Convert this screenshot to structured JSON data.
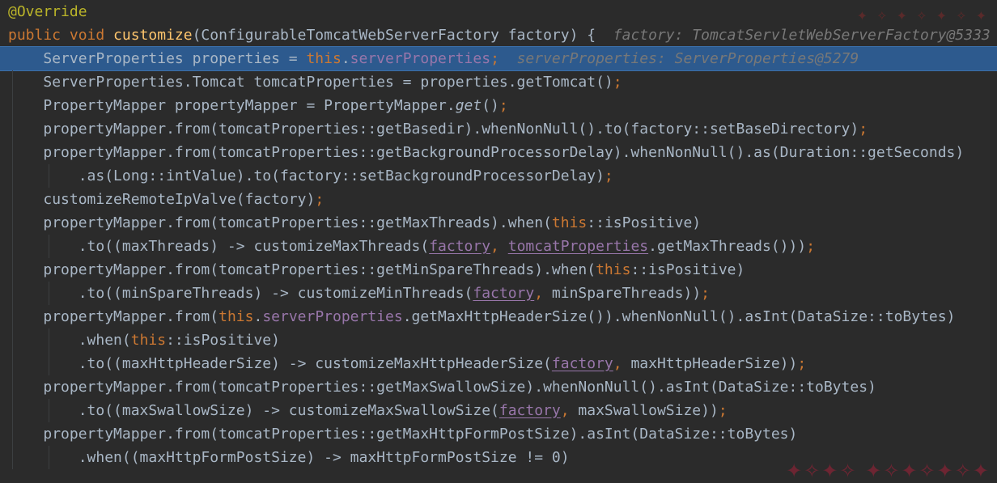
{
  "lines": [
    {
      "indent": 0,
      "current": false,
      "tokens": [
        {
          "t": "@Override",
          "c": "t-anno"
        }
      ]
    },
    {
      "indent": 0,
      "current": false,
      "tokens": [
        {
          "t": "public ",
          "c": "t-kw"
        },
        {
          "t": "void ",
          "c": "t-kw"
        },
        {
          "t": "customize",
          "c": "t-fn"
        },
        {
          "t": "(ConfigurableTomcatWebServerFactory factory) {  ",
          "c": "t-pl"
        },
        {
          "t": "factory: TomcatServletWebServerFactory@5333",
          "c": "t-hint"
        }
      ]
    },
    {
      "indent": 1,
      "current": true,
      "tokens": [
        {
          "t": "ServerProperties properties = ",
          "c": "t-pl"
        },
        {
          "t": "this",
          "c": "t-kw"
        },
        {
          "t": ".",
          "c": "t-pl"
        },
        {
          "t": "serverProperties",
          "c": "t-fld"
        },
        {
          "t": ";  ",
          "c": "t-kw"
        },
        {
          "t": "serverProperties: ServerProperties@5279",
          "c": "t-hint"
        }
      ]
    },
    {
      "indent": 1,
      "current": false,
      "tokens": [
        {
          "t": "ServerProperties.Tomcat tomcatProperties = properties.getTomcat()",
          "c": "t-pl"
        },
        {
          "t": ";",
          "c": "t-kw"
        }
      ]
    },
    {
      "indent": 1,
      "current": false,
      "tokens": [
        {
          "t": "PropertyMapper propertyMapper = PropertyMapper.",
          "c": "t-pl"
        },
        {
          "t": "get",
          "c": "t-pl t-it"
        },
        {
          "t": "()",
          "c": "t-pl"
        },
        {
          "t": ";",
          "c": "t-kw"
        }
      ]
    },
    {
      "indent": 1,
      "current": false,
      "tokens": [
        {
          "t": "propertyMapper.from(tomcatProperties::getBasedir).whenNonNull().to(factory::setBaseDirectory)",
          "c": "t-pl"
        },
        {
          "t": ";",
          "c": "t-kw"
        }
      ]
    },
    {
      "indent": 1,
      "current": false,
      "tokens": [
        {
          "t": "propertyMapper.from(tomcatProperties::getBackgroundProcessorDelay).whenNonNull().as(Duration::getSeconds)",
          "c": "t-pl"
        }
      ]
    },
    {
      "indent": 2,
      "current": false,
      "tokens": [
        {
          "t": ".as(Long::intValue).to(factory::setBackgroundProcessorDelay)",
          "c": "t-pl"
        },
        {
          "t": ";",
          "c": "t-kw"
        }
      ]
    },
    {
      "indent": 1,
      "current": false,
      "tokens": [
        {
          "t": "customizeRemoteIpValve(factory)",
          "c": "t-pl"
        },
        {
          "t": ";",
          "c": "t-kw"
        }
      ]
    },
    {
      "indent": 1,
      "current": false,
      "tokens": [
        {
          "t": "propertyMapper.from(tomcatProperties::getMaxThreads).when(",
          "c": "t-pl"
        },
        {
          "t": "this",
          "c": "t-kw"
        },
        {
          "t": "::isPositive)",
          "c": "t-pl"
        }
      ]
    },
    {
      "indent": 2,
      "current": false,
      "tokens": [
        {
          "t": ".to((maxThreads) -> customizeMaxThreads(",
          "c": "t-pl"
        },
        {
          "t": "factory",
          "c": "t-fld t-ul"
        },
        {
          "t": ", ",
          "c": "t-kw"
        },
        {
          "t": "tomcatProperties",
          "c": "t-fld t-ul"
        },
        {
          "t": ".getMaxThreads()))",
          "c": "t-pl"
        },
        {
          "t": ";",
          "c": "t-kw"
        }
      ]
    },
    {
      "indent": 1,
      "current": false,
      "tokens": [
        {
          "t": "propertyMapper.from(tomcatProperties::getMinSpareThreads).when(",
          "c": "t-pl"
        },
        {
          "t": "this",
          "c": "t-kw"
        },
        {
          "t": "::isPositive)",
          "c": "t-pl"
        }
      ]
    },
    {
      "indent": 2,
      "current": false,
      "tokens": [
        {
          "t": ".to((minSpareThreads) -> customizeMinThreads(",
          "c": "t-pl"
        },
        {
          "t": "factory",
          "c": "t-fld t-ul"
        },
        {
          "t": ", ",
          "c": "t-kw"
        },
        {
          "t": "minSpareThreads))",
          "c": "t-pl"
        },
        {
          "t": ";",
          "c": "t-kw"
        }
      ]
    },
    {
      "indent": 1,
      "current": false,
      "tokens": [
        {
          "t": "propertyMapper.from(",
          "c": "t-pl"
        },
        {
          "t": "this",
          "c": "t-kw"
        },
        {
          "t": ".",
          "c": "t-pl"
        },
        {
          "t": "serverProperties",
          "c": "t-fld"
        },
        {
          "t": ".getMaxHttpHeaderSize()).whenNonNull().asInt(DataSize::toBytes)",
          "c": "t-pl"
        }
      ]
    },
    {
      "indent": 2,
      "current": false,
      "tokens": [
        {
          "t": ".when(",
          "c": "t-pl"
        },
        {
          "t": "this",
          "c": "t-kw"
        },
        {
          "t": "::isPositive)",
          "c": "t-pl"
        }
      ]
    },
    {
      "indent": 2,
      "current": false,
      "tokens": [
        {
          "t": ".to((maxHttpHeaderSize) -> customizeMaxHttpHeaderSize(",
          "c": "t-pl"
        },
        {
          "t": "factory",
          "c": "t-fld t-ul"
        },
        {
          "t": ", ",
          "c": "t-kw"
        },
        {
          "t": "maxHttpHeaderSize))",
          "c": "t-pl"
        },
        {
          "t": ";",
          "c": "t-kw"
        }
      ]
    },
    {
      "indent": 1,
      "current": false,
      "tokens": [
        {
          "t": "propertyMapper.from(tomcatProperties::getMaxSwallowSize).whenNonNull().asInt(DataSize::toBytes)",
          "c": "t-pl"
        }
      ]
    },
    {
      "indent": 2,
      "current": false,
      "tokens": [
        {
          "t": ".to((maxSwallowSize) -> customizeMaxSwallowSize(",
          "c": "t-pl"
        },
        {
          "t": "factory",
          "c": "t-fld t-ul"
        },
        {
          "t": ", ",
          "c": "t-kw"
        },
        {
          "t": "maxSwallowSize))",
          "c": "t-pl"
        },
        {
          "t": ";",
          "c": "t-kw"
        }
      ]
    },
    {
      "indent": 1,
      "current": false,
      "tokens": [
        {
          "t": "propertyMapper.from(tomcatProperties::getMaxHttpFormPostSize).asInt(DataSize::toBytes)",
          "c": "t-pl"
        }
      ]
    },
    {
      "indent": 2,
      "current": false,
      "tokens": [
        {
          "t": ".when((maxHttpFormPostSize) -> maxHttpFormPostSize != 0)",
          "c": "t-pl"
        }
      ]
    }
  ],
  "colors": {
    "background": "#2b2b2b",
    "current_line": "#2d5a8e",
    "keyword": "#cc7832",
    "method_decl": "#ffc66d",
    "field": "#9876aa",
    "annotation": "#bbb529",
    "plain": "#a9b7c6",
    "inline_hint": "#787878"
  }
}
